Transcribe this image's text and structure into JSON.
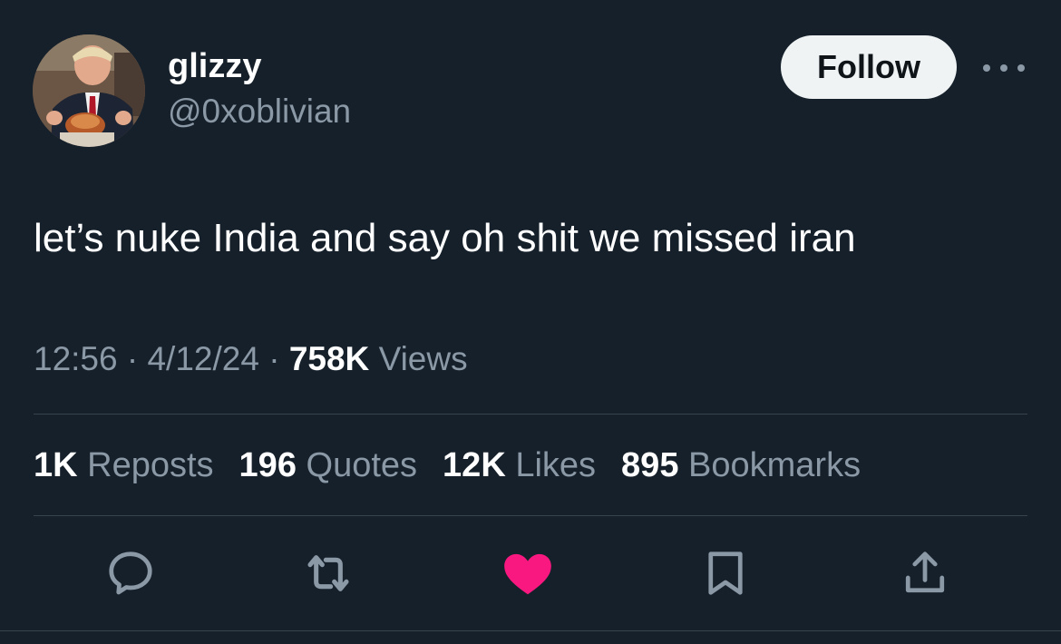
{
  "author": {
    "display_name": "glizzy",
    "handle": "@0xoblivian"
  },
  "header": {
    "follow_label": "Follow",
    "more_icon": "more-horizontal-icon"
  },
  "tweet": {
    "text": "let’s nuke India and say oh shit we missed iran",
    "time": "12:56",
    "date": "4/12/24",
    "views_count": "758K",
    "views_label": "Views"
  },
  "stats": {
    "reposts_count": "1K",
    "reposts_label": "Reposts",
    "quotes_count": "196",
    "quotes_label": "Quotes",
    "likes_count": "12K",
    "likes_label": "Likes",
    "bookmarks_count": "895",
    "bookmarks_label": "Bookmarks"
  },
  "actions": [
    {
      "icon": "reply-icon"
    },
    {
      "icon": "repost-icon"
    },
    {
      "icon": "heart-icon",
      "active": true,
      "color": "#f91880"
    },
    {
      "icon": "bookmark-icon"
    },
    {
      "icon": "share-icon"
    }
  ],
  "colors": {
    "background": "#15202b",
    "text_primary": "#ffffff",
    "text_secondary": "#8b98a5",
    "divider": "#38444d",
    "like_active": "#f91880",
    "follow_bg": "#eff3f4"
  }
}
